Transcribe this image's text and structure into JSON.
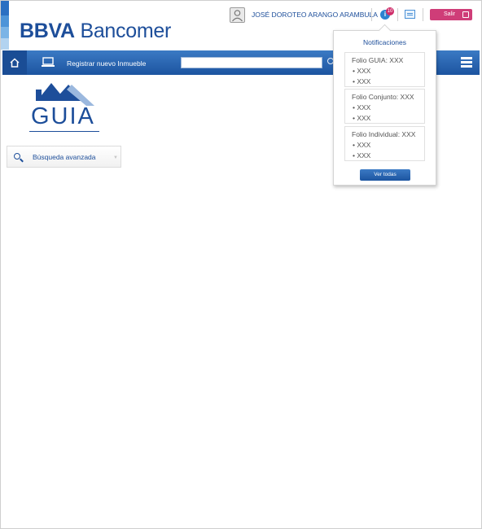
{
  "brand": {
    "name_bold": "BBVA",
    "name_rest": " Bancomer",
    "stripe_colors": [
      "#2a6fc2",
      "#4d94d8",
      "#7bb4e6",
      "#b2d3f0"
    ]
  },
  "header": {
    "user_name": "JOSÉ DOROTEO ARANGO ARAMBULA",
    "notif_icon_glyph": "i",
    "notif_count": "10",
    "logout_label": "Salir"
  },
  "navbar": {
    "register_label": "Registrar nuevo Inmueble",
    "search_value": "",
    "bar_color": "#1c54a0"
  },
  "guia": {
    "logo_text": "GUIA"
  },
  "advanced_search": {
    "label": "Búsqueda avanzada",
    "chevron": "▼"
  },
  "notifications": {
    "title": "Notificaciones",
    "items": [
      {
        "folio": "Folio GUIA: XXX",
        "lines": [
          "• XXX",
          "• XXX"
        ]
      },
      {
        "folio": "Folio Conjunto: XXX",
        "lines": [
          "• XXX",
          "• XXX"
        ]
      },
      {
        "folio": "Folio Individual: XXX",
        "lines": [
          "• XXX",
          "• XXX"
        ]
      }
    ],
    "view_all_label": "Ver todas"
  },
  "icons": {
    "home": "home-icon",
    "laptop": "laptop-icon",
    "search": "search-icon",
    "menu": "hamburger-menu-icon",
    "messages": "messages-icon",
    "logout": "logout-icon",
    "avatar": "user-avatar-icon"
  }
}
